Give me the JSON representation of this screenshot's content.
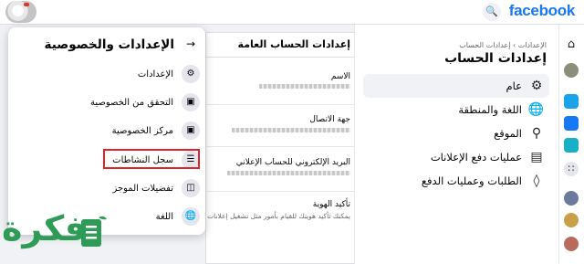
{
  "topbar": {
    "brand": "facebook",
    "search_icon": "search-icon",
    "colors": {
      "brand": "#1877f2"
    }
  },
  "settings_nav": {
    "breadcrumb": "الإعدادات › إعدادات الحساب",
    "title": "إعدادات الحساب",
    "items": [
      {
        "label": "عام",
        "icon": "gear-icon",
        "active": true
      },
      {
        "label": "اللغة والمنطقة",
        "icon": "globe-icon",
        "active": false
      },
      {
        "label": "الموقع",
        "icon": "location-icon",
        "active": false
      },
      {
        "label": "عمليات دفع الإعلانات",
        "icon": "credit-card-icon",
        "active": false
      },
      {
        "label": "الطلبات وعمليات الدفع",
        "icon": "tag-icon",
        "active": false
      }
    ]
  },
  "main": {
    "title": "إعدادات الحساب العامة",
    "fields": [
      {
        "label": "الاسم"
      },
      {
        "label": "جهة الاتصال"
      },
      {
        "label": "البريد الإلكتروني للحساب الإعلاني"
      },
      {
        "label": "تأكيد الهوية",
        "note": "يمكنك تأكيد هويتك للقيام بأمور مثل تشغيل إعلانات"
      }
    ]
  },
  "panel": {
    "title": "الإعدادات والخصوصية",
    "items": [
      {
        "label": "الإعدادات",
        "icon": "gear-icon"
      },
      {
        "label": "التحقق من الخصوصية",
        "icon": "lock-icon"
      },
      {
        "label": "مركز الخصوصية",
        "icon": "lock-icon"
      },
      {
        "label": "سجل النشاطات",
        "icon": "list-icon",
        "highlighted": true
      },
      {
        "label": "تفضيلات الموجز",
        "icon": "feed-icon"
      },
      {
        "label": "اللغة",
        "icon": "globe-icon"
      }
    ],
    "highlight_color": "#e0232a"
  },
  "watermark": {
    "text": "فكرة",
    "color": "#2e9b57"
  }
}
